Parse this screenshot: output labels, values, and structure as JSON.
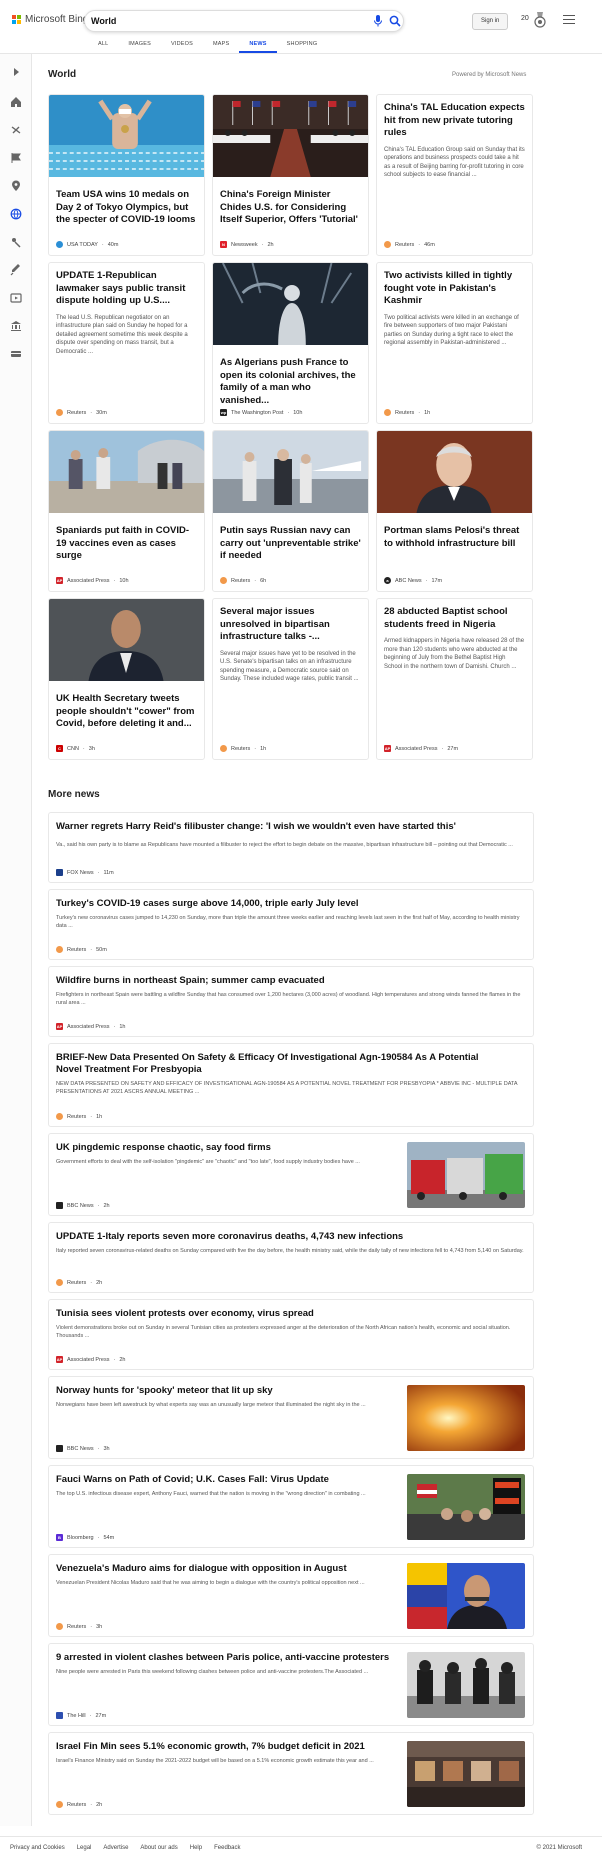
{
  "header": {
    "brand": "Microsoft Bing",
    "search_value": "World",
    "signin_label": "Sign in",
    "points": "20",
    "tabs": [
      "ALL",
      "IMAGES",
      "VIDEOS",
      "MAPS",
      "NEWS",
      "SHOPPING"
    ],
    "active_tab": "NEWS"
  },
  "section": {
    "title": "World",
    "powered_by": "Powered by Microsoft News"
  },
  "cards": [
    {
      "headline": "Team USA wins 10 medals on Day 2 of Tokyo Olympics, but the specter of COVID-19 looms",
      "summary": "",
      "source": "USA TODAY",
      "time": "40m",
      "icon": "usa-today-icon",
      "color": "#2b8fd6"
    },
    {
      "headline": "China's Foreign Minister Chides U.S. for Considering Itself Superior, Offers 'Tutorial'",
      "summary": "",
      "source": "Newsweek",
      "time": "2h",
      "icon": "newsweek-icon",
      "color": "#e0202a"
    },
    {
      "headline": "China's TAL Education expects hit from new private tutoring rules",
      "summary": "China's TAL Education Group said on Sunday that its operations and business prospects could take a hit as a result of Beijing barring for-profit tutoring in core school subjects to ease financial ...",
      "source": "Reuters",
      "time": "46m",
      "icon": "reuters-icon",
      "color": "#f2994a"
    },
    {
      "headline": "UPDATE 1-Republican lawmaker says public transit dispute holding up U.S....",
      "summary": "The lead U.S. Republican negotiator on an infrastructure plan said on Sunday he hoped for a detailed agreement sometime this week despite a dispute over spending on mass transit, but a Democratic ...",
      "source": "Reuters",
      "time": "30m",
      "icon": "reuters-icon",
      "color": "#f2994a"
    },
    {
      "headline": "As Algerians push France to open its colonial archives, the family of a man who vanished...",
      "summary": "",
      "source": "The Washington Post",
      "time": "10h",
      "icon": "washington-post-icon",
      "color": "#222222"
    },
    {
      "headline": "Two activists killed in tightly fought vote in Pakistan's Kashmir",
      "summary": "Two political activists were killed in an exchange of fire between supporters of two major Pakistani parties on Sunday during a tight race to elect the regional assembly in Pakistan-administered ...",
      "source": "Reuters",
      "time": "1h",
      "icon": "reuters-icon",
      "color": "#f2994a"
    },
    {
      "headline": "Spaniards put faith in COVID-19 vaccines even as cases surge",
      "summary": "",
      "source": "Associated Press",
      "time": "10h",
      "icon": "ap-icon",
      "color": "#d2232a"
    },
    {
      "headline": "Putin says Russian navy can carry out 'unpreventable strike' if needed",
      "summary": "",
      "source": "Reuters",
      "time": "6h",
      "icon": "reuters-icon",
      "color": "#f2994a"
    },
    {
      "headline": "Portman slams Pelosi's threat to withhold infrastructure bill",
      "summary": "",
      "source": "ABC News",
      "time": "17m",
      "icon": "abc-news-icon",
      "color": "#222222"
    },
    {
      "headline": "UK Health Secretary tweets people shouldn't \"cower\" from Covid, before deleting it and...",
      "summary": "",
      "source": "CNN",
      "time": "3h",
      "icon": "cnn-icon",
      "color": "#cc0000"
    },
    {
      "headline": "Several major issues unresolved in bipartisan infrastructure talks -...",
      "summary": "Several major issues have yet to be resolved in the U.S. Senate's bipartisan talks on an infrastructure spending measure, a Democratic source said on Sunday. These included wage rates, public transit ...",
      "source": "Reuters",
      "time": "1h",
      "icon": "reuters-icon",
      "color": "#f2994a"
    },
    {
      "headline": "28 abducted Baptist school students freed in Nigeria",
      "summary": "Armed kidnappers in Nigeria have released 28 of the more than 120 students who were abducted at the beginning of July from the Bethel Baptist High School in the northern town of Damishi. Church ...",
      "source": "Associated Press",
      "time": "27m",
      "icon": "ap-icon",
      "color": "#d2232a"
    }
  ],
  "more_news": {
    "title": "More news",
    "items": [
      {
        "headline": "Warner regrets Harry Reid's filibuster change: 'I wish we wouldn't even have started this'",
        "summary": "Va., said his own party is to blame as Republicans have mounted a filibuster to reject the effort to begin debate on the massive, bipartisan infrastructure bill – pointing out that Democratic ...",
        "source": "FOX News",
        "time": "11m",
        "color": "#1b3f8b"
      },
      {
        "headline": "Turkey's COVID-19 cases surge above 14,000, triple early July level",
        "summary": "Turkey's new coronavirus cases jumped to 14,230 on Sunday, more than triple the amount three weeks earlier and reaching levels last seen in the first half of May, according to health ministry data ...",
        "source": "Reuters",
        "time": "50m",
        "color": "#f2994a"
      },
      {
        "headline": "Wildfire burns in northeast Spain; summer camp evacuated",
        "summary": "Firefighters in northeast Spain were battling a wildfire Sunday that has consumed over 1,200 hectares (3,000 acres) of woodland. High temperatures and strong winds fanned the flames in the rural area ...",
        "source": "Associated Press",
        "time": "1h",
        "color": "#d2232a"
      },
      {
        "headline": "BRIEF-New Data Presented On Safety & Efficacy Of Investigational Agn-190584 As A Potential Novel Treatment For Presbyopia",
        "summary": "NEW DATA PRESENTED ON SAFETY AND EFFICACY OF INVESTIGATIONAL AGN-190584 AS A POTENTIAL NOVEL TREATMENT FOR PRESBYOPIA * ABBVIE INC - MULTIPLE DATA PRESENTATIONS AT 2021 ASCRS ANNUAL MEETING ...",
        "source": "Reuters",
        "time": "1h",
        "color": "#f2994a"
      },
      {
        "headline": "UK pingdemic response chaotic, say food firms",
        "summary": "Government efforts to deal with the self-isolation \"pingdemic\" are \"chaotic\" and \"too late\", food supply industry bodies have ...",
        "source": "BBC News",
        "time": "2h",
        "color": "#222222"
      },
      {
        "headline": "UPDATE 1-Italy reports seven more coronavirus deaths, 4,743 new infections",
        "summary": "Italy reported seven coronavirus-related deaths on Sunday compared with five the day before, the health ministry said, while the daily tally of new infections fell to 4,743 from 5,140 on Saturday.",
        "source": "Reuters",
        "time": "2h",
        "color": "#f2994a"
      },
      {
        "headline": "Tunisia sees violent protests over economy, virus spread",
        "summary": "Violent demonstrations broke out on Sunday in several Tunisian cities as protesters expressed anger at the deterioration of the North African nation's health, economic and social situation. Thousands ...",
        "source": "Associated Press",
        "time": "2h",
        "color": "#d2232a"
      },
      {
        "headline": "Norway hunts for 'spooky' meteor that lit up sky",
        "summary": "Norwegians have been left awestruck by what experts say was an unusually large meteor that illuminated the night sky in the ...",
        "source": "BBC News",
        "time": "3h",
        "color": "#222222"
      },
      {
        "headline": "Fauci Warns on Path of Covid; U.K. Cases Fall: Virus Update",
        "summary": "The top U.S. infectious disease expert, Anthony Fauci, warned that the nation is moving in the \"wrong direction\" in combating ...",
        "source": "Bloomberg",
        "time": "54m",
        "color": "#5b2bd6"
      },
      {
        "headline": "Venezuela's Maduro aims for dialogue with opposition in August",
        "summary": "Venezuelan President Nicolas Maduro said that he was aiming to begin a dialogue with the country's political opposition next ...",
        "source": "Reuters",
        "time": "3h",
        "color": "#f2994a"
      },
      {
        "headline": "9 arrested in violent clashes between Paris police, anti-vaccine protesters",
        "summary": "Nine people were arrested in Paris this weekend following clashes between police and anti-vaccine protesters.The Associated ...",
        "source": "The Hill",
        "time": "27m",
        "color": "#2d4fb0"
      },
      {
        "headline": "Israel Fin Min sees 5.1% economic growth, 7% budget deficit in 2021",
        "summary": "Israel's Finance Ministry said on Sunday the 2021-2022 budget will be based on a 5.1% economic growth estimate this year and ...",
        "source": "Reuters",
        "time": "2h",
        "color": "#f2994a"
      }
    ]
  },
  "footer": {
    "links": [
      "Privacy and Cookies",
      "Legal",
      "Advertise",
      "About our ads",
      "Help",
      "Feedback"
    ],
    "copyright": "© 2021 Microsoft"
  }
}
